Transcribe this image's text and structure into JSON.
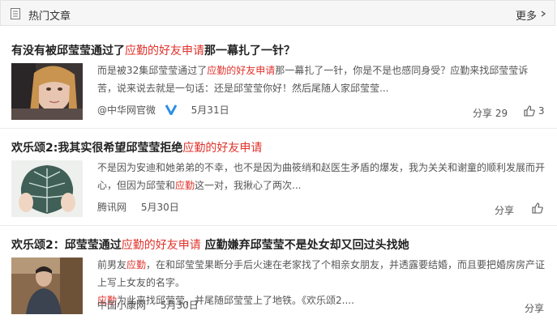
{
  "header": {
    "title": "热门文章",
    "more_label": "更多"
  },
  "articles": [
    {
      "title_pre": "有没有被邱莹莹通过了",
      "title_hl": "应勤的好友申请",
      "title_post": "那一幕扎了一针？",
      "summary_line1_pre": "而是被32集邱莹莹通过了",
      "summary_line1_hl": "应勤的好友申请",
      "summary_line1_post": "那一幕扎了一针，你是不是也感同身受？应勤来找邱莹莹诉",
      "summary_line2": "苦，说来说去就是一句话：还是邱莹莹你好！然后尾随人家邱莹莹...",
      "source": "@中华网官微",
      "date": "5月31日",
      "share": "分享 29",
      "likes": "3"
    },
    {
      "title_pre": "欢乐颂2:我其实很希望邱莹莹拒绝",
      "title_hl": "应勤的好友申请",
      "title_post": "",
      "summary_line1": "不是因为安迪和她弟弟的不幸，也不是因为曲筱绡和赵医生矛盾的爆发，我为关关和谢童的顺利发展而开",
      "summary_line2_pre": "心，但因为邱莹和",
      "summary_line2_hl": "应勤",
      "summary_line2_post": "这一对，我揪心了两次...",
      "source": "腾讯网",
      "date": "5月30日",
      "share": "分享"
    },
    {
      "title_pre": "欢乐颂2：邱莹莹通过",
      "title_hl": "应勤的好友申请",
      "title_post": " 应勤嫌弃邱莹莹不是处女却又回过头找她",
      "summary_line1_pre": "前男友",
      "summary_line1_hl": "应勤",
      "summary_line1_post": "，在和邱莹莹果断分手后火速在老家找了个相亲女朋友，并透露要结婚，而且要把婚房房产证",
      "summary_line2": "上写上女友的名字。",
      "summary_line3_hl": "应勤",
      "summary_line3_post": "为此来找邱莹莹，并尾随邱莹莹上了地铁。《欢乐颂2....",
      "source": "中国小康网",
      "date": "5月30日",
      "share": "分享"
    }
  ],
  "colors": {
    "highlight": "#e0322b",
    "verified": "#2d8ee6",
    "header_bg": "#f6f6f6"
  }
}
